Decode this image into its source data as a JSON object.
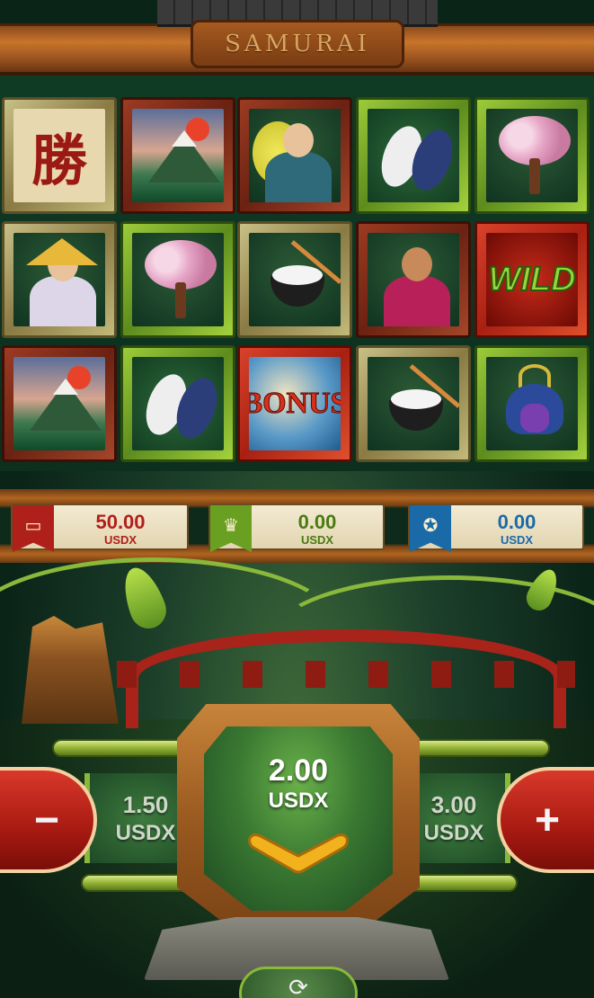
{
  "header": {
    "title": "SAMURAI"
  },
  "reels": [
    [
      {
        "symbol": "kanji-tile",
        "text": "勝",
        "frame": "bamboo"
      },
      {
        "symbol": "mount-fuji",
        "text": "",
        "frame": "red"
      },
      {
        "symbol": "geisha",
        "text": "",
        "frame": "red"
      },
      {
        "symbol": "koi-fish",
        "text": "",
        "frame": "green"
      },
      {
        "symbol": "cherry-blossom-tree",
        "text": "",
        "frame": "green"
      }
    ],
    [
      {
        "symbol": "old-sage",
        "text": "",
        "frame": "bamboo"
      },
      {
        "symbol": "cherry-blossom-tree",
        "text": "",
        "frame": "green"
      },
      {
        "symbol": "sushi-bowl",
        "text": "",
        "frame": "bamboo"
      },
      {
        "symbol": "samurai-warrior",
        "text": "",
        "frame": "red"
      },
      {
        "symbol": "wild-dragon",
        "text": "WILD",
        "frame": "redbright"
      }
    ],
    [
      {
        "symbol": "mount-fuji",
        "text": "",
        "frame": "red"
      },
      {
        "symbol": "koi-fish",
        "text": "",
        "frame": "green"
      },
      {
        "symbol": "bonus-wave",
        "text": "BONUS",
        "frame": "redbright"
      },
      {
        "symbol": "sushi-bowl",
        "text": "",
        "frame": "bamboo"
      },
      {
        "symbol": "samurai-helmet",
        "text": "",
        "frame": "green"
      }
    ]
  ],
  "balances": [
    {
      "icon": "wallet-icon",
      "amount": "50.00",
      "unit": "USDX",
      "color": "#b0201a",
      "icon_bg": "#b0201a"
    },
    {
      "icon": "trophy-icon",
      "amount": "0.00",
      "unit": "USDX",
      "color": "#4a7a12",
      "icon_bg": "#6aa022"
    },
    {
      "icon": "ribbon-icon",
      "amount": "0.00",
      "unit": "USDX",
      "color": "#1a6aa8",
      "icon_bg": "#1a6aa8"
    }
  ],
  "bet": {
    "current": "2.00",
    "current_unit": "USDX",
    "lower": "1.50",
    "lower_unit": "USDX",
    "higher": "3.00",
    "higher_unit": "USDX",
    "decrease_label": "−",
    "increase_label": "+"
  },
  "colors": {
    "accent_red": "#a81a12",
    "bamboo_green": "#8ab83a",
    "gold": "#f2b21e"
  }
}
